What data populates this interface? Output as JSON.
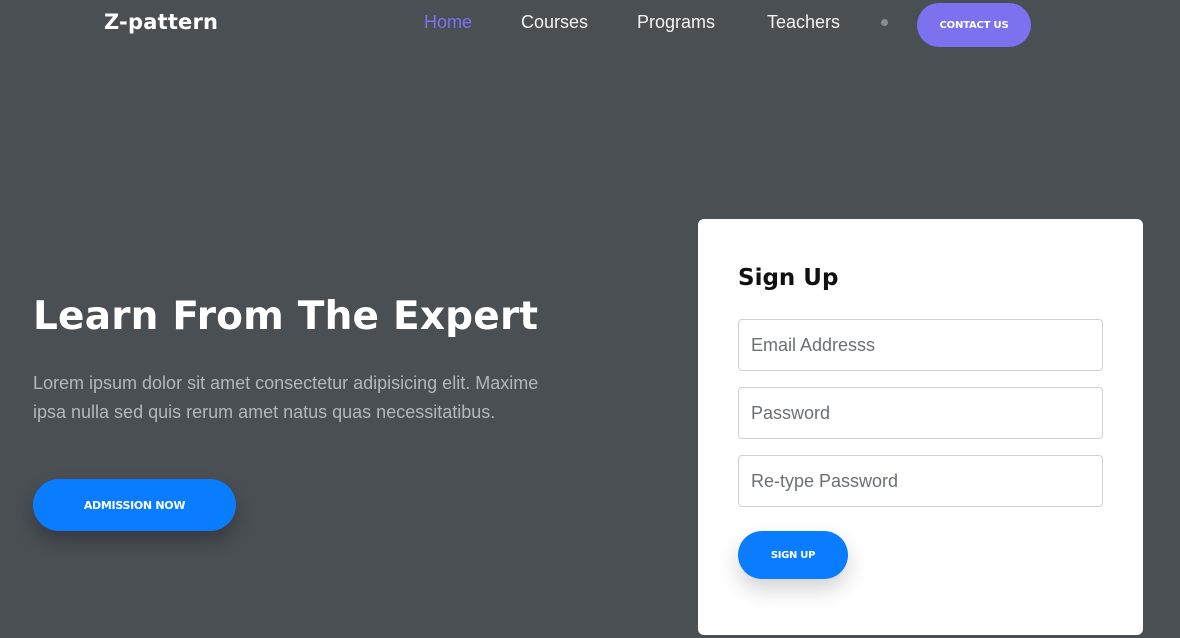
{
  "header": {
    "brand": "Z-pattern",
    "nav": [
      {
        "label": "Home",
        "active": true
      },
      {
        "label": "Courses",
        "active": false
      },
      {
        "label": "Programs",
        "active": false
      },
      {
        "label": "Teachers",
        "active": false
      }
    ],
    "contact_label": "Contact Us"
  },
  "hero": {
    "title": "Learn From The Expert",
    "text": "Lorem ipsum dolor sit amet consectetur adipisicing elit. Maxime ipsa nulla sed quis rerum amet natus quas necessitatibus.",
    "cta_label": "Admission Now"
  },
  "signup": {
    "title": "Sign Up",
    "email_placeholder": "Email Addresss",
    "password_placeholder": "Password",
    "retype_placeholder": "Re-type Password",
    "button_label": "Sign Up"
  },
  "colors": {
    "background": "#4a4f54",
    "accent": "#7c71ee",
    "primary": "#0a7cff"
  }
}
